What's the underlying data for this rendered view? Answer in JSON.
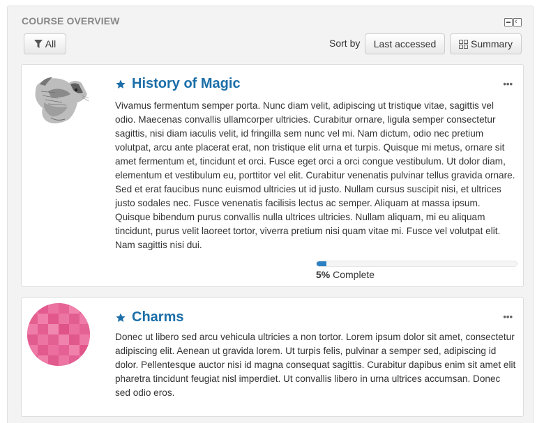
{
  "block": {
    "title": "COURSE OVERVIEW",
    "controls": [
      "minimize-icon",
      "dock-icon"
    ]
  },
  "toolbar": {
    "filter_label": "All",
    "filter_icon": "filter-icon",
    "sort_label": "Sort by",
    "sort_value": "Last accessed",
    "view_label": "Summary",
    "view_icon": "grid-icon"
  },
  "courses": [
    {
      "title": "History of Magic",
      "starred": true,
      "image": "hare-sketch",
      "description": "Vivamus fermentum semper porta. Nunc diam velit, adipiscing ut tristique vitae, sagittis vel odio. Maecenas convallis ullamcorper ultricies. Curabitur ornare, ligula semper consectetur sagittis, nisi diam iaculis velit, id fringilla sem nunc vel mi. Nam dictum, odio nec pretium volutpat, arcu ante placerat erat, non tristique elit urna et turpis. Quisque mi metus, ornare sit amet fermentum et, tincidunt et orci. Fusce eget orci a orci congue vestibulum. Ut dolor diam, elementum et vestibulum eu, porttitor vel elit. Curabitur venenatis pulvinar tellus gravida ornare. Sed et erat faucibus nunc euismod ultricies ut id justo. Nullam cursus suscipit nisi, et ultrices justo sodales nec. Fusce venenatis facilisis lectus ac semper. Aliquam at massa ipsum. Quisque bibendum purus convallis nulla ultrices ultricies. Nullam aliquam, mi eu aliquam tincidunt, purus velit laoreet tortor, viverra pretium nisi quam vitae mi. Fusce vel volutpat elit. Nam sagittis nisi dui.",
      "progress_percent": 5,
      "progress_value": "5%",
      "progress_suffix": " Complete",
      "menu_icon": "more-icon"
    },
    {
      "title": "Charms",
      "starred": true,
      "image": "pink-pattern",
      "description": "Donec ut libero sed arcu vehicula ultricies a non tortor. Lorem ipsum dolor sit amet, consectetur adipiscing elit. Aenean ut gravida lorem. Ut turpis felis, pulvinar a semper sed, adipiscing id dolor. Pellentesque auctor nisi id magna consequat sagittis. Curabitur dapibus enim sit amet elit pharetra tincidunt feugiat nisl imperdiet. Ut convallis libero in urna ultrices accumsan. Donec sed odio eros.",
      "menu_icon": "more-icon"
    }
  ],
  "colors": {
    "title_link": "#1b6ea8",
    "progress": "#2c7fc1",
    "block_bg": "#f3f3f3",
    "charms_pink": "#e8679a"
  }
}
